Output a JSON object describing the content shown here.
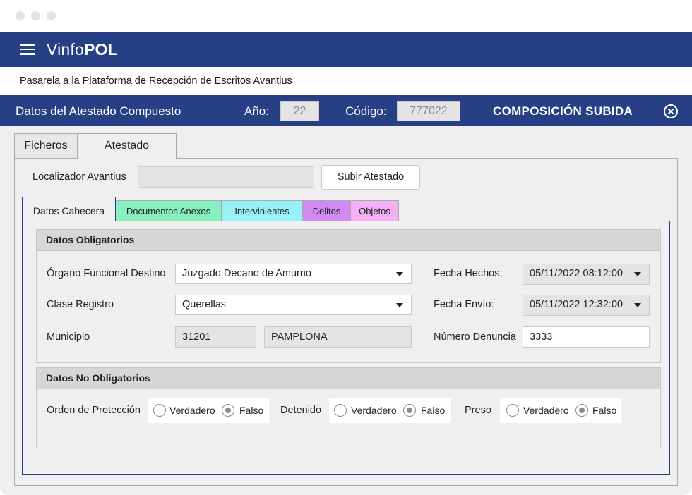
{
  "app": {
    "name_light": "Vinfo",
    "name_bold": "POL"
  },
  "subtitle": "Pasarela a la Plataforma de Recepción de Escritos Avantius",
  "dialog": {
    "title": "Datos del Atestado Compuesto",
    "year_label": "Año:",
    "year_value": "22",
    "code_label": "Código:",
    "code_value": "777022",
    "status": "COMPOSICIÓN SUBIDA"
  },
  "tabs": {
    "ficheros": "Ficheros",
    "atestado": "Atestado"
  },
  "localizador": {
    "label": "Localizador Avantius",
    "value": "",
    "button": "Subir Atestado"
  },
  "subtabs": {
    "cabecera": "Datos Cabecera",
    "documentos": "Documentos Anexos",
    "intervinientes": "Intervinientes",
    "delitos": "Delitos",
    "objetos": "Objetos"
  },
  "obligatorios": {
    "title": "Datos Obligatorios",
    "organo_label": "Órgano Funcional Destino",
    "organo_value": "Juzgado Decano de Amurrio",
    "clase_label": "Clase Registro",
    "clase_value": "Querellas",
    "municipio_label": "Municipio",
    "municipio_code": "31201",
    "municipio_name": "PAMPLONA",
    "fecha_hechos_label": "Fecha Hechos:",
    "fecha_hechos_value": "05/11/2022 08:12:00",
    "fecha_envio_label": "Fecha Envío:",
    "fecha_envio_value": "05/11/2022 12:32:00",
    "denuncia_label": "Número Denuncia",
    "denuncia_value": "3333"
  },
  "no_obligatorios": {
    "title": "Datos No Obligatorios",
    "true_label": "Verdadero",
    "false_label": "Falso",
    "orden_label": "Orden de Protección",
    "detenido_label": "Detenido",
    "preso_label": "Preso"
  },
  "colors": {
    "brand": "#273f85",
    "tab_documentos": "#88f0c0",
    "tab_intervinientes": "#96f2f6",
    "tab_delitos": "#d18af2",
    "tab_objetos": "#f4b0f4"
  }
}
